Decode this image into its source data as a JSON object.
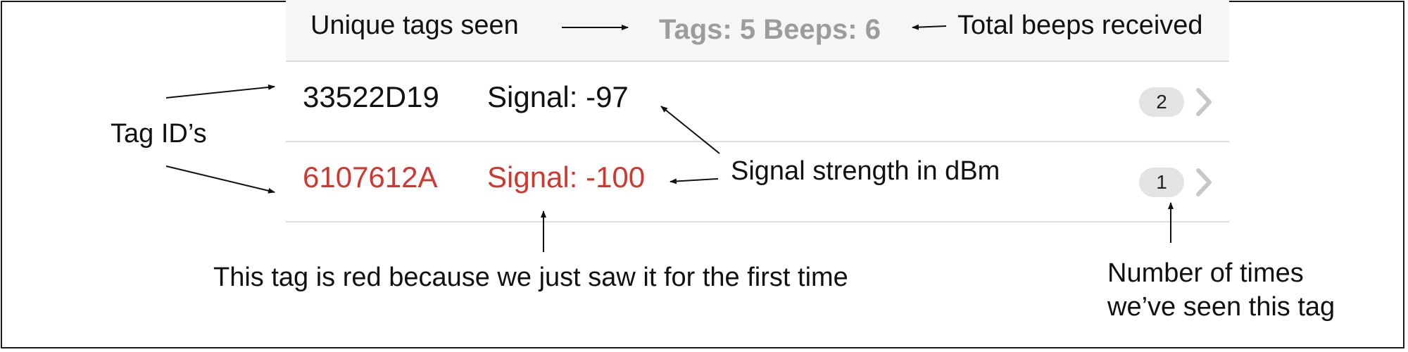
{
  "header": {
    "tags_label": "Tags: 5",
    "beeps_label": "Beeps: 6"
  },
  "rows": [
    {
      "tag_id": "33522D19",
      "signal": "Signal: -97",
      "count": "2",
      "color": "#111111"
    },
    {
      "tag_id": "6107612A",
      "signal": "Signal: -100",
      "count": "1",
      "color": "#d0382f"
    }
  ],
  "annotations": {
    "unique_tags": "Unique tags seen",
    "total_beeps": "Total beeps received",
    "tag_ids": "Tag ID’s",
    "signal_strength": "Signal strength in dBm",
    "red_tag": "This tag is red because we just saw it for the first time",
    "times_seen_line1": "Number of times",
    "times_seen_line2": "we’ve seen this tag"
  },
  "colors": {
    "header_text": "#9c9c9c",
    "new_tag": "#d0382f",
    "badge_bg": "#e3e3e3"
  },
  "icons": {
    "row_disclosure": "chevron-right-icon"
  }
}
